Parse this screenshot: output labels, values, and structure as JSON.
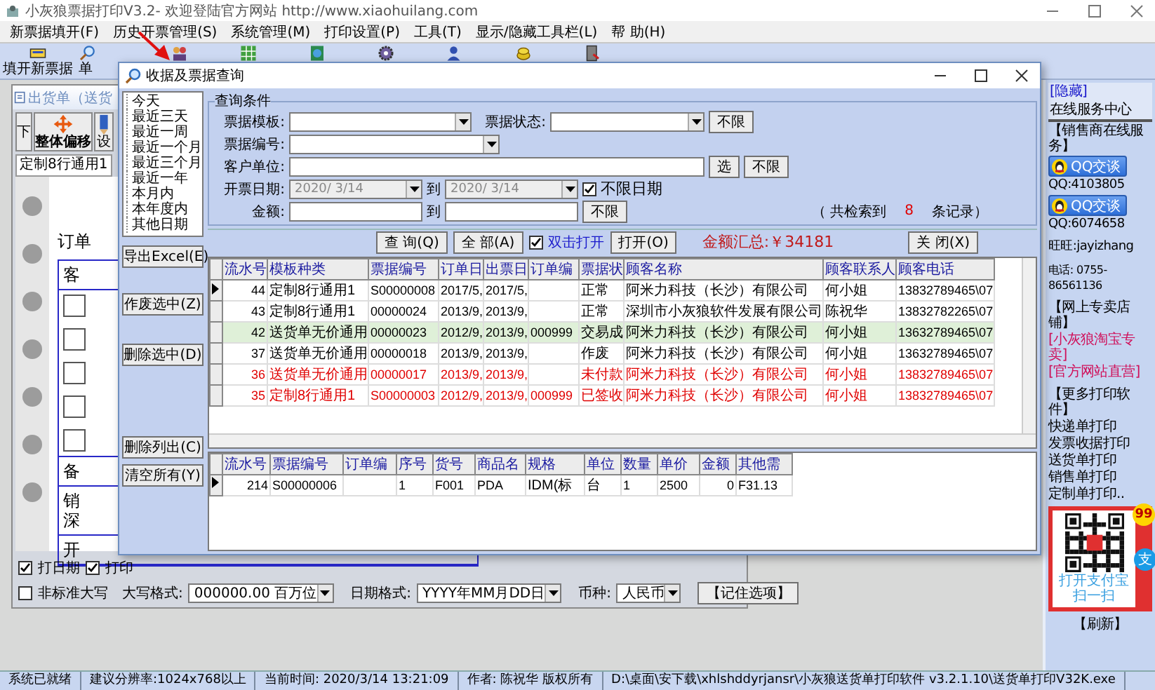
{
  "window": {
    "title": "小灰狼票据打印V3.2- 欢迎登陆官方网站 http://www.xiaohuilang.com"
  },
  "menu": [
    "新票据填开(F)",
    "历史开票管理(S)",
    "系统管理(M)",
    "打印设置(P)",
    "工具(T)",
    "显示/隐藏工具栏(L)",
    "帮 助(H)"
  ],
  "toolbar": [
    {
      "kind": "new",
      "label": "填开新票据"
    },
    {
      "kind": "search",
      "label": "单"
    },
    {
      "kind": "people"
    },
    {
      "kind": "grid"
    },
    {
      "kind": "globe"
    },
    {
      "kind": "gear"
    },
    {
      "kind": "user"
    },
    {
      "kind": "coins"
    },
    {
      "kind": "exit"
    }
  ],
  "editor": {
    "header": "出货单（送货",
    "buttons": [
      {
        "kind": "edge",
        "label": "下"
      },
      {
        "kind": "move",
        "label": "整体偏移"
      },
      {
        "kind": "design",
        "label": "设"
      }
    ],
    "tab": "定制8行通用1",
    "doc_title": "订单",
    "form": [
      "客",
      "备",
      "销",
      "深",
      "开"
    ]
  },
  "options": {
    "print_flags": [
      {
        "label": "打日期",
        "checked": true
      },
      {
        "label": "打印",
        "checked": true
      }
    ],
    "nonstandard": {
      "label": "非标准大写",
      "checked": false
    },
    "fields": [
      {
        "label": "大写格式:",
        "value": "000000.00 百万位"
      },
      {
        "label": "日期格式:",
        "value": "YYYY年MM月DD日"
      },
      {
        "label": "币种:",
        "value": "人民币"
      }
    ],
    "remember": "【记住选项】"
  },
  "dialog": {
    "title": "收据及票据查询",
    "date_tree": [
      "今天",
      "最近三天",
      "最近一周",
      "最近一个月",
      "最近三个月",
      "最近一年",
      "本月内",
      "本年度内",
      "其他日期"
    ],
    "side_buttons": [
      "导出Excel(E)",
      "作废选中(Z)",
      "删除选中(D)",
      "删除列出(C)",
      "清空所有(Y)"
    ],
    "conditions": {
      "legend": "查询条件",
      "template": {
        "label": "票据模板:"
      },
      "status": {
        "label": "票据状态:",
        "reset": "不限"
      },
      "number": {
        "label": "票据编号:"
      },
      "customer": {
        "label": "客户单位:",
        "pick": "选",
        "reset": "不限"
      },
      "date": {
        "label": "开票日期:",
        "from": "2020/ 3/14",
        "to_label": "到",
        "to": "2020/ 3/14",
        "no_limit": {
          "label": "不限日期",
          "checked": true
        }
      },
      "amount": {
        "label": "金额:",
        "to_label": "到",
        "reset": "不限"
      },
      "result": {
        "prefix": "（ 共检索到",
        "count": "8",
        "suffix": "条记录）"
      }
    },
    "actions": {
      "query": "查 询(Q)",
      "all": "全 部(A)",
      "dblclick": {
        "label": "双击打开",
        "checked": true
      },
      "open": "打开(O)",
      "total": "金额汇总:￥34181",
      "close": "关 闭(X)"
    },
    "records": {
      "columns": [
        "流水号",
        "模板种类",
        "票据编号",
        "订单日",
        "出票日",
        "订单编",
        "票据状",
        "顾客名称",
        "顾客联系人",
        "顾客电话"
      ],
      "rows": [
        {
          "cells": [
            "44",
            "定制8行通用1",
            "S00000008",
            "2017/5,",
            "2017/5,",
            "",
            "正常",
            "阿米力科技（长沙）有限公司",
            "何小姐",
            "13832789465\\07"
          ],
          "color": "#000000",
          "selected": false,
          "current": true
        },
        {
          "cells": [
            "43",
            "定制8行通用1",
            "00000024",
            "2013/9,",
            "2013/9,",
            "",
            "正常",
            "深圳市小灰狼软件发展有限公司",
            "陈祝华",
            "13832782265\\07"
          ],
          "color": "#000000",
          "selected": false,
          "current": false
        },
        {
          "cells": [
            "42",
            "送货单无价通用",
            "00000023",
            "2012/9,",
            "2013/9,",
            "000999",
            "交易成",
            "阿米力科技（长沙）有限公司",
            "何小姐",
            "13632789465\\07"
          ],
          "color": "#000000",
          "selected": true,
          "current": false
        },
        {
          "cells": [
            "37",
            "送货单无价通用",
            "00000018",
            "2013/9,",
            "2013/9,",
            "",
            "作废",
            "阿米力科技（长沙）有限公司",
            "何小姐",
            "13632789465\\07"
          ],
          "color": "#000000",
          "selected": false,
          "current": false
        },
        {
          "cells": [
            "36",
            "送货单无价通用",
            "00000017",
            "2013/9,",
            "2013/9,",
            "",
            "未付款",
            "阿米力科技（长沙）有限公司",
            "何小姐",
            "13832789465\\07"
          ],
          "color": "#e00000",
          "selected": false,
          "current": false
        },
        {
          "cells": [
            "35",
            "定制8行通用1",
            "S00000003",
            "2012/9,",
            "2013/9,",
            "000999",
            "已签收",
            "阿米力科技（长沙）有限公司",
            "何小姐",
            "13832789465\\07"
          ],
          "color": "#e00000",
          "selected": false,
          "current": false
        }
      ]
    },
    "items": {
      "columns": [
        "流水号",
        "票据编号",
        "订单编",
        "序号",
        "货号",
        "商品名",
        "规格",
        "单位",
        "数量",
        "单价",
        "金额",
        "其他需"
      ],
      "rows": [
        {
          "cells": [
            "214",
            "S00000006",
            "",
            "1",
            "F001",
            "PDA",
            "IDM(标",
            "台",
            "1",
            "2500",
            "0",
            "F31.13"
          ],
          "current": true
        }
      ]
    }
  },
  "sidebar": {
    "hide": "[隐藏]",
    "title": "在线服务中心",
    "seller": "【销售商在线服务】",
    "qq": [
      {
        "button": "QQ交谈",
        "number": "QQ:4103805"
      },
      {
        "button": "QQ交谈",
        "number": "QQ:6074658"
      }
    ],
    "wangwang": "旺旺:jayizhang",
    "phone": "电话: 0755-86561136",
    "shop_title": "【网上专卖店铺】",
    "shop_links": [
      "[小灰狼淘宝专卖]",
      "[官方网站直营]"
    ],
    "more_title": "【更多打印软件】",
    "more_links": [
      "快递单打印",
      "发票收据打印",
      "送货单打印",
      "销售单打印",
      "定制单打印.."
    ],
    "qr_badge": "99",
    "qr_logo": "支",
    "qr_caption": "打开支付宝扫一扫",
    "refresh": "【刷新】"
  },
  "status_bar": [
    "系统已就绪",
    "建议分辨率:1024x768以上",
    "当前时间: 2020/3/14 13:21:09",
    "作者: 陈祝华 版权所有",
    "D:\\桌面\\安下载\\xhlshddyrjansr\\小灰狼送货单打印软件 v3.2.1.10\\送货单打印V32K.exe"
  ]
}
